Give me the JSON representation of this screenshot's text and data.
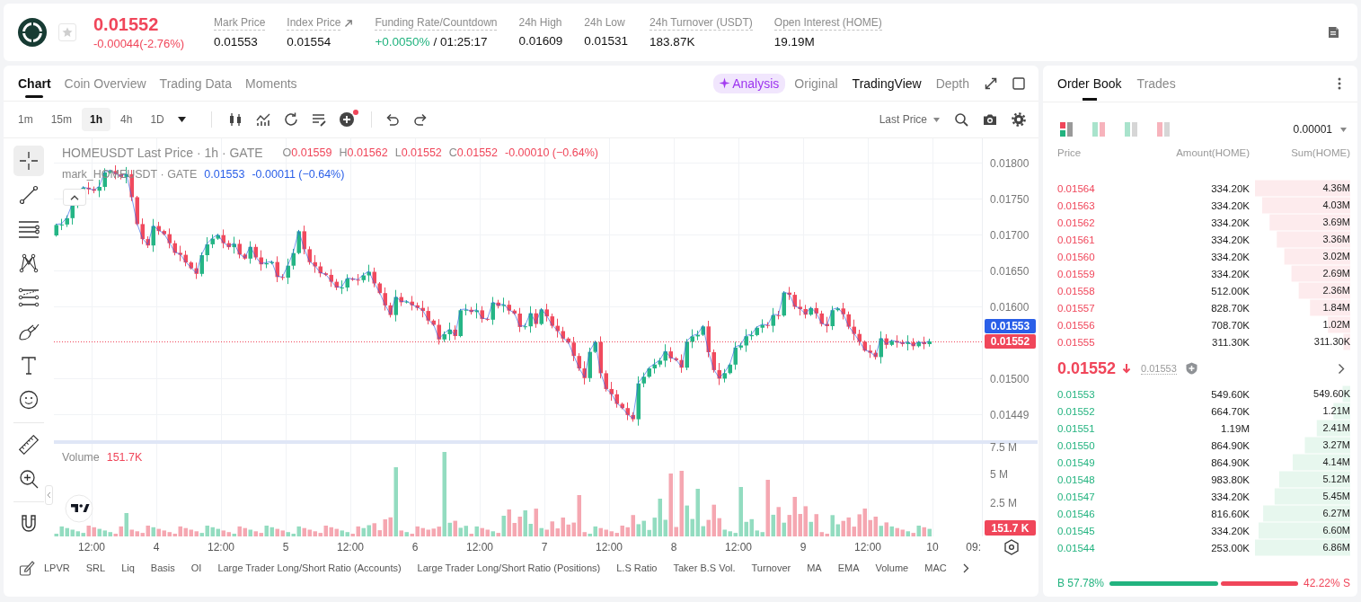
{
  "ticker": {
    "favorite": false,
    "price": "0.01552",
    "change": "-0.00044(-2.76%)",
    "stats": [
      {
        "label": "Mark Price",
        "kind": "plain",
        "tooltip": true,
        "link": false,
        "value": "0.01553"
      },
      {
        "label": "Index Price",
        "kind": "plain",
        "tooltip": true,
        "link": true,
        "value": "0.01554"
      },
      {
        "label": "Funding Rate/Countdown",
        "kind": "funding",
        "tooltip": true,
        "link": false,
        "value": "+0.0050%",
        "countdown": "/ 01:25:17"
      },
      {
        "label": "24h High",
        "kind": "plain",
        "tooltip": false,
        "link": false,
        "value": "0.01609"
      },
      {
        "label": "24h Low",
        "kind": "plain",
        "tooltip": false,
        "link": false,
        "value": "0.01531"
      },
      {
        "label": "24h Turnover (USDT)",
        "kind": "plain",
        "tooltip": true,
        "link": false,
        "value": "183.87K"
      },
      {
        "label": "Open Interest (HOME)",
        "kind": "plain",
        "tooltip": true,
        "link": false,
        "value": "19.19M"
      }
    ]
  },
  "chart_panel": {
    "tabs": [
      {
        "label": "Chart",
        "selected": true
      },
      {
        "label": "Coin Overview",
        "selected": false
      },
      {
        "label": "Trading Data",
        "selected": false
      },
      {
        "label": "Moments",
        "selected": false
      }
    ],
    "views": [
      {
        "label": "Analysis",
        "kind": "ai",
        "selected": false
      },
      {
        "label": "Original",
        "kind": "plain",
        "selected": false
      },
      {
        "label": "TradingView",
        "kind": "plain",
        "selected": true
      },
      {
        "label": "Depth",
        "kind": "plain",
        "selected": false
      }
    ],
    "intervals": [
      {
        "label": "1m",
        "selected": false
      },
      {
        "label": "15m",
        "selected": false
      },
      {
        "label": "1h",
        "selected": true
      },
      {
        "label": "4h",
        "selected": false
      },
      {
        "label": "1D",
        "selected": false
      }
    ],
    "alert_dot": true,
    "price_source": "Last Price",
    "tool_groups": [
      {
        "tools": [
          {
            "kind": "crosshair",
            "selected": true
          },
          {
            "kind": "trend-line",
            "selected": false
          },
          {
            "kind": "parallel-lines",
            "selected": false
          },
          {
            "kind": "pattern",
            "selected": false
          },
          {
            "kind": "fib",
            "selected": false
          },
          {
            "kind": "brush",
            "selected": false
          },
          {
            "kind": "text",
            "selected": false
          },
          {
            "kind": "emoji",
            "selected": false
          }
        ]
      },
      {
        "tools": [
          {
            "kind": "ruler",
            "selected": false
          },
          {
            "kind": "zoom",
            "selected": false
          }
        ]
      },
      {
        "tools": [
          {
            "kind": "magnet",
            "selected": false
          }
        ]
      }
    ],
    "legend": {
      "title": "HOMEUSDT Last Price · 1h · GATE",
      "ohlc": [
        {
          "key": "O",
          "value": "0.01559"
        },
        {
          "key": "H",
          "value": "0.01562"
        },
        {
          "key": "L",
          "value": "0.01552"
        },
        {
          "key": "C",
          "value": "0.01552"
        }
      ],
      "change": "-0.00010 (−0.64%)"
    },
    "mark_legend": {
      "title": "mark_HOMEUSDT · GATE",
      "value": "0.01553",
      "change": "-0.00011 (−0.64%)"
    },
    "price_axis": [
      "0.01800",
      "0.01750",
      "0.01700",
      "0.01650",
      "0.01600",
      "0.01500",
      "0.01449"
    ],
    "price_badges": [
      {
        "kind": "mark",
        "value": "0.01553"
      },
      {
        "kind": "last",
        "value": "0.01552"
      }
    ],
    "volume_legend": {
      "title": "Volume",
      "value": "151.7K"
    },
    "volume_axis": [
      "7.5 M",
      "5 M",
      "2.5 M"
    ],
    "volume_badge": "151.7 K",
    "time_axis": [
      "12:00",
      "4",
      "12:00",
      "5",
      "12:00",
      "6",
      "12:00",
      "7",
      "12:00",
      "8",
      "12:00",
      "9",
      "12:00",
      "10",
      "09:"
    ],
    "indicators": [
      "LPVR",
      "SRL",
      "Liq",
      "Basis",
      "OI",
      "Large Trader Long/Short Ratio (Accounts)",
      "Large Trader Long/Short Ratio (Positions)",
      "L.S Ratio",
      "Taker B.S Vol.",
      "Turnover",
      "MA",
      "EMA",
      "Volume",
      "MAC"
    ]
  },
  "order_book": {
    "tabs": [
      {
        "label": "Order Book",
        "selected": true
      },
      {
        "label": "Trades",
        "selected": false
      }
    ],
    "layouts": [
      {
        "kind": "both",
        "selected": true
      },
      {
        "kind": "split",
        "selected": false
      },
      {
        "kind": "bids",
        "selected": false
      },
      {
        "kind": "asks",
        "selected": false
      }
    ],
    "precision": "0.00001",
    "columns": [
      "Price",
      "Amount(HOME)",
      "Sum(HOME)"
    ],
    "asks": [
      {
        "price": "0.01564",
        "amount": "334.20K",
        "sum": "4.36M"
      },
      {
        "price": "0.01563",
        "amount": "334.20K",
        "sum": "4.03M"
      },
      {
        "price": "0.01562",
        "amount": "334.20K",
        "sum": "3.69M"
      },
      {
        "price": "0.01561",
        "amount": "334.20K",
        "sum": "3.36M"
      },
      {
        "price": "0.01560",
        "amount": "334.20K",
        "sum": "3.02M"
      },
      {
        "price": "0.01559",
        "amount": "334.20K",
        "sum": "2.69M"
      },
      {
        "price": "0.01558",
        "amount": "512.00K",
        "sum": "2.36M"
      },
      {
        "price": "0.01557",
        "amount": "828.70K",
        "sum": "1.84M"
      },
      {
        "price": "0.01556",
        "amount": "708.70K",
        "sum": "1.02M"
      },
      {
        "price": "0.01555",
        "amount": "311.30K",
        "sum": "311.30K"
      }
    ],
    "mid": {
      "price": "0.01552",
      "falling": true,
      "mark_price": "0.01553"
    },
    "bids": [
      {
        "price": "0.01553",
        "amount": "549.60K",
        "sum": "549.60K"
      },
      {
        "price": "0.01552",
        "amount": "664.70K",
        "sum": "1.21M"
      },
      {
        "price": "0.01551",
        "amount": "1.19M",
        "sum": "2.41M"
      },
      {
        "price": "0.01550",
        "amount": "864.90K",
        "sum": "3.27M"
      },
      {
        "price": "0.01549",
        "amount": "864.90K",
        "sum": "4.14M"
      },
      {
        "price": "0.01548",
        "amount": "983.80K",
        "sum": "5.12M"
      },
      {
        "price": "0.01547",
        "amount": "334.20K",
        "sum": "5.45M"
      },
      {
        "price": "0.01546",
        "amount": "816.60K",
        "sum": "6.27M"
      },
      {
        "price": "0.01545",
        "amount": "334.20K",
        "sum": "6.60M"
      },
      {
        "price": "0.01544",
        "amount": "253.00K",
        "sum": "6.86M"
      }
    ],
    "ratio": {
      "buy": "B 57.78%",
      "sell": "42.22% S",
      "level": 0.5778
    }
  }
}
